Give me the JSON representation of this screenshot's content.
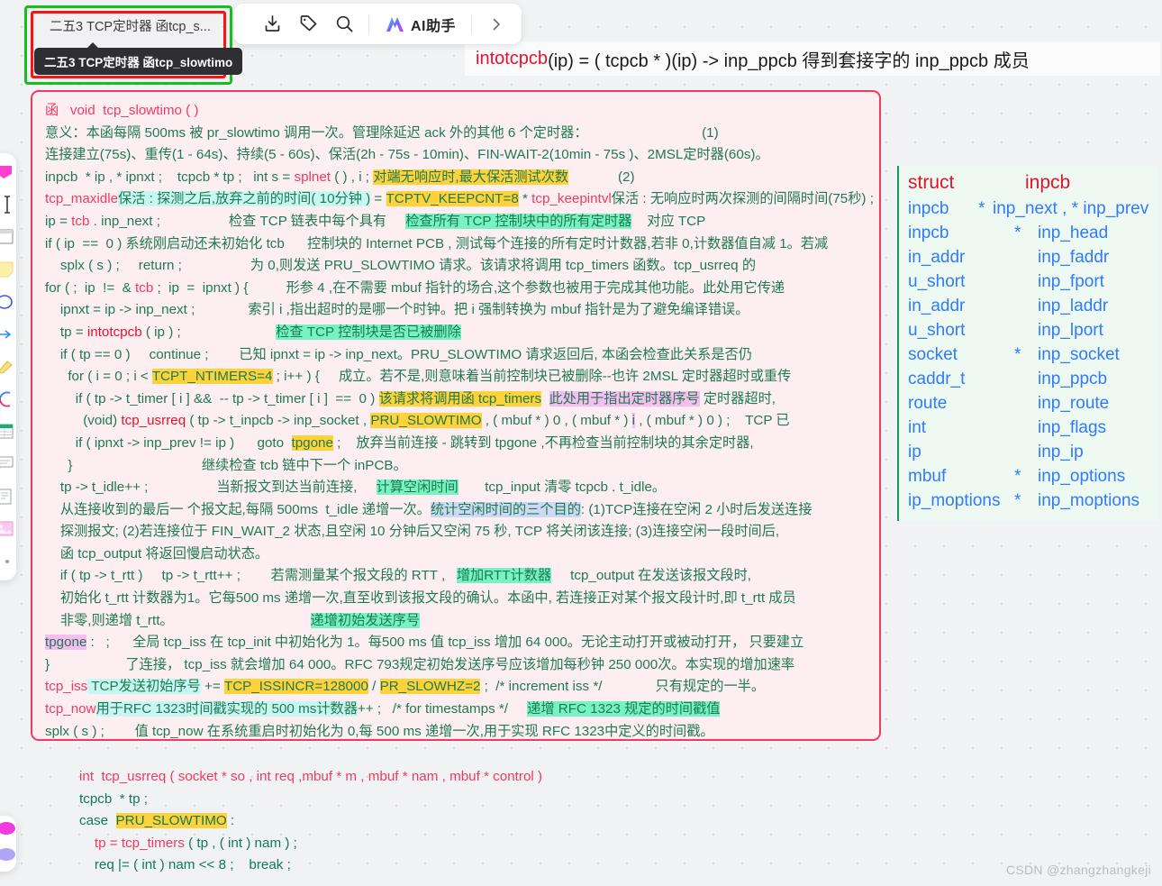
{
  "window": {
    "title_chip": "二五3 TCP定时器 函tcp_s...",
    "tooltip": "二五3 TCP定时器 函tcp_slowtimo"
  },
  "toolbar": {
    "icons": [
      {
        "name": "download-icon",
        "label": "下载"
      },
      {
        "name": "tag-icon",
        "label": "标签"
      },
      {
        "name": "search-icon",
        "label": "搜索"
      }
    ],
    "ai_button_label": "AI助手",
    "expand_label": "›"
  },
  "left_rail": {
    "items": [
      {
        "name": "shape-icon"
      },
      {
        "name": "text-cursor-icon"
      },
      {
        "name": "sticky-frame-icon"
      },
      {
        "name": "note-icon"
      },
      {
        "name": "circle-shape-icon"
      },
      {
        "name": "arrow-icon"
      },
      {
        "name": "pen-icon"
      },
      {
        "name": "curve-icon"
      },
      {
        "name": "table-icon"
      },
      {
        "name": "comment-icon"
      },
      {
        "name": "list-icon"
      },
      {
        "name": "image-icon"
      },
      {
        "name": "more-dot-icon"
      }
    ],
    "bottom_items": [
      {
        "name": "magenta-dot-icon"
      },
      {
        "name": "purple-dot-icon"
      }
    ]
  },
  "banner": {
    "fn": "intotcpcb",
    "rest": "(ip) =  ( tcpcb * )(ip) -> inp_ppcb   得到套接字的 inp_ppcb 成员"
  },
  "code_card": {
    "lines": [
      [
        {
          "t": "函   ",
          "c": "c-pink"
        },
        {
          "t": "void  tcp_slowtimo ( )",
          "c": "c-pink"
        }
      ],
      [
        {
          "t": "意义：本函每隔 500ms 被 pr_slowtimo 调用一次。管理除延迟 ack 外的其他 6 个定时器：",
          "c": "c-green"
        },
        {
          "t": "                              (1)",
          "c": "c-green"
        }
      ],
      [
        {
          "t": "连接建立(75s)、重传(1 - 64s)、持续(5 - 60s)、保活(2h - 75s - 10min)、FIN-WAIT-2(10min - 75s )、2MSL定时器(60s)。",
          "c": "c-green"
        }
      ],
      [
        {
          "t": "inpcb  * ip , * ipnxt ;    tcpcb * tp ;   int s = ",
          "c": "c-green"
        },
        {
          "t": "splnet",
          "c": "c-pink"
        },
        {
          "t": " ( ) , i ; ",
          "c": "c-green"
        },
        {
          "t": "对端无响应时,最大保活测试次数",
          "c": "c-green",
          "h": "hl-y"
        },
        {
          "t": "             (2)",
          "c": "c-green"
        }
      ],
      [
        {
          "t": "tcp_maxidle",
          "c": "c-pink"
        },
        {
          "t": "保活 : 探测之后,放弃之前的时间( 10分钟 )",
          "c": "c-green",
          "h": "hl-c"
        },
        {
          "t": " = ",
          "c": "c-green"
        },
        {
          "t": "TCPTV_KEEPCNT=8",
          "c": "c-green",
          "h": "hl-y"
        },
        {
          "t": " * ",
          "c": "c-green"
        },
        {
          "t": "tcp_keepintvl",
          "c": "c-pink"
        },
        {
          "t": "保活 : 无响应时两次探测的间隔时间(75秒)",
          "c": "c-green"
        },
        {
          "t": " ;",
          "c": "c-green"
        }
      ],
      [
        {
          "t": "ip = ",
          "c": "c-green"
        },
        {
          "t": "tcb",
          "c": "c-pink"
        },
        {
          "t": " . inp_next ;                  检查 TCP 链表中每个具有     ",
          "c": "c-green"
        },
        {
          "t": "检查所有 TCP 控制块中的所有定时器",
          "c": "c-green",
          "h": "hl-g"
        },
        {
          "t": "    对应 TCP",
          "c": "c-green"
        }
      ],
      [
        {
          "t": "if ( ip  ==  0 ) ",
          "c": "c-green"
        },
        {
          "t": "系统刚启动还未初始化 tcb",
          "c": "c-green"
        },
        {
          "t": "      控制块的 Internet PCB , 测试每个连接的所有定时计数器,若非 0,计数器值自减 1。若减",
          "c": "c-green"
        }
      ],
      [
        {
          "t": "    splx ( s ) ;     return ;                  为 0,则发送 PRU_SLOWTIMO 请求。该请求将调用 tcp_timers 函数。tcp_usrreq 的",
          "c": "c-green"
        }
      ],
      [
        {
          "t": "for ( ;  ip  !=  & ",
          "c": "c-green"
        },
        {
          "t": "tcb",
          "c": "c-pink"
        },
        {
          "t": " ;  ip  =  ipnxt ) {          形参 4 ,在不需要 mbuf 指针的场合,这个参数也被用于完成其他功能。此处用它传递",
          "c": "c-green"
        }
      ],
      [
        {
          "t": "    ipnxt = ip -> inp_next ;              索引 i ,指出超时的是哪一个时钟。把 i 强制转换为 mbuf 指针是为了避免编译错误。",
          "c": "c-green"
        }
      ],
      [
        {
          "t": "    tp = ",
          "c": "c-green"
        },
        {
          "t": "intotcpcb",
          "c": "c-red"
        },
        {
          "t": " ( ip ) ;                         ",
          "c": "c-green"
        },
        {
          "t": "检查 TCP 控制块是否已被删除",
          "c": "c-green",
          "h": "hl-g"
        }
      ],
      [
        {
          "t": "    if ( tp == 0 )     continue ;        已知 ipnxt = ip -> inp_next。PRU_SLOWTIMO 请求返回后, 本函会检查此关系是否仍",
          "c": "c-green"
        }
      ],
      [
        {
          "t": "      for ( i = 0 ; i < ",
          "c": "c-green"
        },
        {
          "t": "TCPT_NTIMERS=4",
          "c": "c-green",
          "h": "hl-y"
        },
        {
          "t": " ; i++ ) {     成立。若不是,则意味着当前控制块已被删除--也许 2MSL 定时器超时或重传",
          "c": "c-green"
        }
      ],
      [
        {
          "t": "        if ( tp -> t_timer [ i ] &&  -- tp -> t_timer [ i ]  ==  0 ) ",
          "c": "c-green"
        },
        {
          "t": "该请求将调用函 tcp_timers",
          "c": "c-green",
          "h": "hl-y"
        },
        {
          "t": "  ",
          "c": "c-green"
        },
        {
          "t": "此处用于指出定时器序号",
          "c": "c-green",
          "h": "hl-p"
        },
        {
          "t": " 定时器超时,",
          "c": "c-green"
        }
      ],
      [
        {
          "t": "          (void) ",
          "c": "c-green"
        },
        {
          "t": "tcp_usrreq",
          "c": "c-red"
        },
        {
          "t": " ( tp -> t_inpcb -> inp_socket , ",
          "c": "c-green"
        },
        {
          "t": "PRU_SLOWTIMO",
          "c": "c-green",
          "h": "hl-y"
        },
        {
          "t": " , ( mbuf * ) 0 , ( mbuf * ) ",
          "c": "c-green"
        },
        {
          "t": "i",
          "c": "c-green",
          "h": "hl-p"
        },
        {
          "t": " , ( mbuf * ) 0 ) ;    TCP 已",
          "c": "c-green"
        }
      ],
      [
        {
          "t": "        if ( ipnxt -> inp_prev != ip )      goto  ",
          "c": "c-green"
        },
        {
          "t": "tpgone",
          "c": "c-green",
          "h": "hl-y"
        },
        {
          "t": " ;    放弃当前连接 - 跳转到 tpgone ,不再检查当前控制块的其余定时器,",
          "c": "c-green"
        }
      ],
      [
        {
          "t": "      }                                  继续检查 tcb 链中下一个 inPCB。",
          "c": "c-green"
        }
      ],
      [
        {
          "t": "    tp -> t_idle++ ;                  当新报文到达当前连接,     ",
          "c": "c-green"
        },
        {
          "t": "计算空闲时间",
          "c": "c-green",
          "h": "hl-g"
        },
        {
          "t": "       tcp_input 清零 tcpcb . t_idle。",
          "c": "c-green"
        }
      ],
      [
        {
          "t": "    从连接收到的最后一 个报文起,每隔 500ms  t_idle 递增一次。",
          "c": "c-green"
        },
        {
          "t": "统计空闲时间的三个目的",
          "c": "c-green",
          "h": "hl-b"
        },
        {
          "t": ": (1)TCP连接在空闲 2 小时后发送连接",
          "c": "c-green"
        }
      ],
      [
        {
          "t": "    探测报文; (2)若连接位于 FIN_WAIT_2 状态,且空闲 10 分钟后又空闲 75 秒, TCP 将关闭该连接; (3)连接空闲一段时间后,",
          "c": "c-green"
        }
      ],
      [
        {
          "t": "    函 tcp_output 将返回慢启动状态。",
          "c": "c-green"
        }
      ],
      [
        {
          "t": "    if ( tp -> t_rtt )     tp -> t_rtt++ ;        若需测量某个报文段的 RTT ,   ",
          "c": "c-green"
        },
        {
          "t": "增加RTT计数器",
          "c": "c-green",
          "h": "hl-g"
        },
        {
          "t": "     tcp_output 在发送该报文段时,",
          "c": "c-green"
        }
      ],
      [
        {
          "t": "    初始化 t_rtt 计数器为1。它每500 ms 递增一次,直至收到该报文段的确认。本函中, 若连接正对某个报文段计时,即 t_rtt 成员",
          "c": "c-green"
        }
      ],
      [
        {
          "t": "    非零,则递增 t_rtt。                                    ",
          "c": "c-green"
        },
        {
          "t": "递增初始发送序号",
          "c": "c-green",
          "h": "hl-g"
        }
      ],
      [
        {
          "t": "tpgone",
          "c": "c-green",
          "h": "hl-p"
        },
        {
          "t": " :   ;      全局 tcp_iss 在 tcp_init 中初始化为 1。每500 ms 值 tcp_iss 增加 64 000。无论主动打开或被动打开， 只要建立",
          "c": "c-green"
        }
      ],
      [
        {
          "t": "}                    了连接， tcp_iss 就会增加 64 000。RFC 793规定初始发送序号应该增加每秒钟 250 000次。本实现的增加速率",
          "c": "c-green"
        }
      ],
      [
        {
          "t": "tcp_iss",
          "c": "c-pink"
        },
        {
          "t": " TCP发送初始序号",
          "c": "c-green",
          "h": "hl-c"
        },
        {
          "t": " += ",
          "c": "c-green"
        },
        {
          "t": "TCP_ISSINCR=128000",
          "c": "c-green",
          "h": "hl-y"
        },
        {
          "t": " / ",
          "c": "c-green"
        },
        {
          "t": "PR_SLOWHZ=2",
          "c": "c-green",
          "h": "hl-y"
        },
        {
          "t": " ;  /* increment iss */              只有规定的一半。",
          "c": "c-green"
        }
      ],
      [
        {
          "t": "tcp_now",
          "c": "c-pink"
        },
        {
          "t": "用于RFC 1323时间戳实现的 500 ms计数器",
          "c": "c-green",
          "h": "hl-c"
        },
        {
          "t": "++ ;   /* for timestamps */     ",
          "c": "c-green"
        },
        {
          "t": "递增 RFC 1323 规定的时间戳值",
          "c": "c-green",
          "h": "hl-g"
        }
      ],
      [
        {
          "t": "splx ( s ) ;        值 tcp_now 在系统重启时初始化为 0,每 500 ms 递增一次,用于实现 RFC 1323中定义的时间戳。",
          "c": "c-green"
        }
      ]
    ]
  },
  "struct_panel": {
    "title_type": "struct",
    "title_name": "inpcb",
    "rows": [
      {
        "type": "inpcb",
        "star": "*",
        "field": "inp_next , * inp_prev",
        "inline": true
      },
      {
        "type": "inpcb",
        "star": "*",
        "field": "inp_head"
      },
      {
        "type": "in_addr",
        "star": "",
        "field": "inp_faddr"
      },
      {
        "type": "u_short",
        "star": "",
        "field": "inp_fport"
      },
      {
        "type": "in_addr",
        "star": "",
        "field": "inp_laddr"
      },
      {
        "type": "u_short",
        "star": "",
        "field": "inp_lport"
      },
      {
        "type": "socket",
        "star": "*",
        "field": "inp_socket"
      },
      {
        "type": "caddr_t",
        "star": "",
        "field": "inp_ppcb"
      },
      {
        "type": "route",
        "star": "",
        "field": "inp_route"
      },
      {
        "type": "int",
        "star": "",
        "field": "inp_flags"
      },
      {
        "type": "ip",
        "star": "",
        "field": "inp_ip"
      },
      {
        "type": "mbuf",
        "star": "*",
        "field": "inp_options"
      },
      {
        "type": "ip_moptions",
        "star": "*",
        "field": "inp_moptions"
      }
    ]
  },
  "bottom_code": {
    "lines": [
      [
        {
          "t": "int  tcp_usrreq ( socket * so , int req ,mbuf * m , mbuf * nam , mbuf * control )",
          "c": "c-pink"
        }
      ],
      [
        {
          "t": "tcpcb  * tp ;",
          "c": "c-teal"
        }
      ],
      [
        {
          "t": "case  ",
          "c": "c-teal"
        },
        {
          "t": "PRU_SLOWTIMO",
          "c": "c-teal",
          "h": "hl-y"
        },
        {
          "t": " :",
          "c": "c-teal"
        }
      ],
      [
        {
          "t": "    tp = ",
          "c": "c-pink"
        },
        {
          "t": "tcp_timers",
          "c": "c-pink"
        },
        {
          "t": " ( tp , ( int ) nam ) ;",
          "c": "c-teal"
        }
      ],
      [
        {
          "t": "    req |= ( int ) nam << 8 ;    break ;",
          "c": "c-teal"
        }
      ]
    ]
  },
  "watermark": "CSDN @zhangzhangkeji",
  "colors": {
    "red_frame": "#f71414",
    "green_frame": "#15c01c",
    "card_border": "#ef3b63",
    "card_bg": "#fdeef1",
    "struct_bg": "#edf9f1",
    "struct_accent": "#0f9b5e",
    "struct_text": "#2f7bfb",
    "keyword_red": "#e8112d",
    "highlight_yellow": "#ffd23a",
    "highlight_green": "#77f2c2",
    "highlight_cyan": "#c8f7f2",
    "highlight_pink": "#f7bdf0",
    "highlight_blue": "#cdd9f5",
    "canvas_bg": "#f1f2f4"
  }
}
